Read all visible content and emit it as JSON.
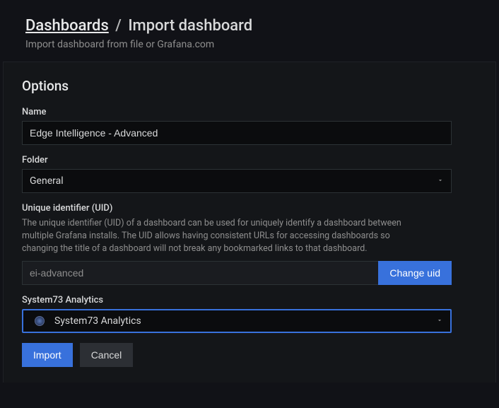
{
  "header": {
    "breadcrumb_root": "Dashboards",
    "breadcrumb_current": "Import dashboard",
    "subtitle": "Import dashboard from file or Grafana.com"
  },
  "section": {
    "title": "Options"
  },
  "fields": {
    "name": {
      "label": "Name",
      "value": "Edge Intelligence - Advanced"
    },
    "folder": {
      "label": "Folder",
      "value": "General"
    },
    "uid": {
      "label": "Unique identifier (UID)",
      "help": "The unique identifier (UID) of a dashboard can be used for uniquely identify a dashboard between multiple Grafana installs. The UID allows having consistent URLs for accessing dashboards so changing the title of a dashboard will not break any bookmarked links to that dashboard.",
      "value": "ei-advanced",
      "change_label": "Change uid"
    },
    "datasource": {
      "label": "System73 Analytics",
      "value": "System73 Analytics"
    }
  },
  "actions": {
    "import": "Import",
    "cancel": "Cancel"
  }
}
